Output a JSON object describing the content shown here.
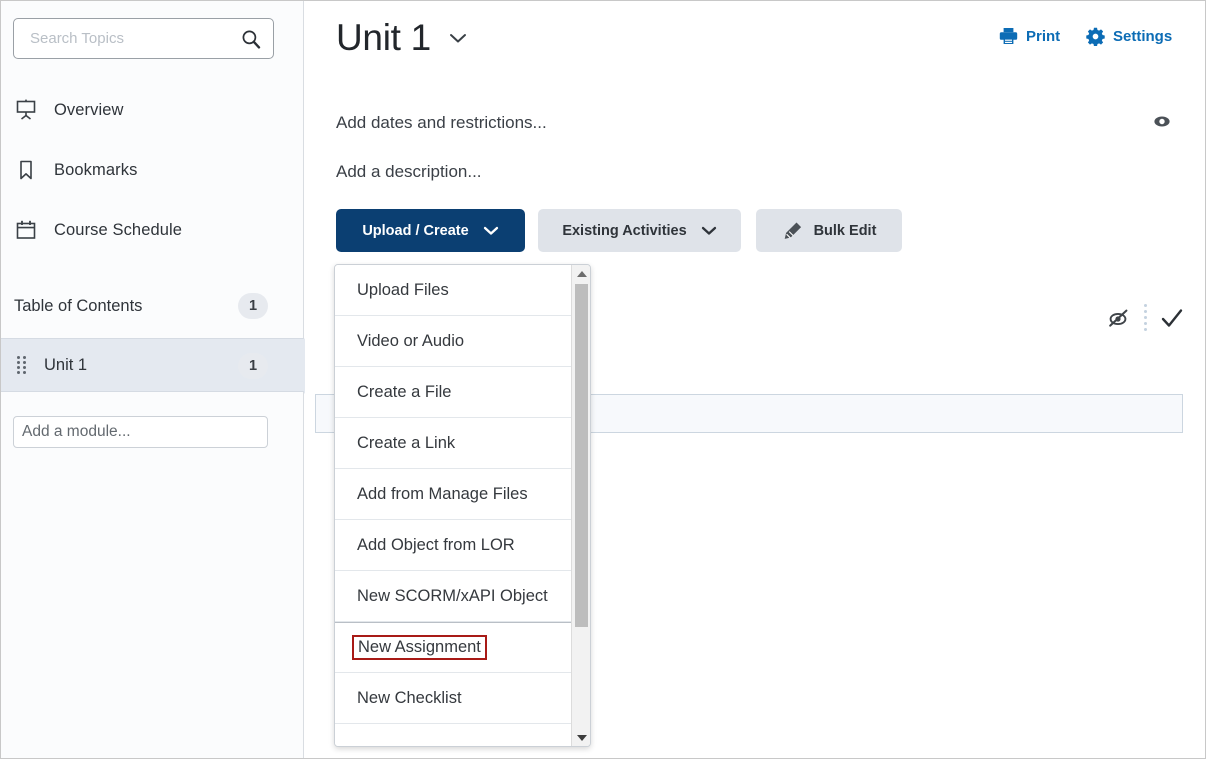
{
  "sidebar": {
    "search": {
      "placeholder": "Search Topics",
      "value": "",
      "icon": "search-icon"
    },
    "items": [
      {
        "label": "Overview",
        "icon": "presentation-screen-icon"
      },
      {
        "label": "Bookmarks",
        "icon": "bookmark-icon"
      },
      {
        "label": "Course Schedule",
        "icon": "calendar-icon"
      }
    ],
    "toc": {
      "label": "Table of Contents",
      "count": "1"
    },
    "module": {
      "label": "Unit 1",
      "count": "1",
      "icon": "drag-grip-icon",
      "selected": true
    },
    "add_module": {
      "placeholder": "Add a module..."
    }
  },
  "header": {
    "title": "Unit 1",
    "title_caret_icon": "chevron-down-icon",
    "print": {
      "label": "Print",
      "icon": "printer-icon"
    },
    "settings": {
      "label": "Settings",
      "icon": "gear-icon"
    },
    "preview_icon": "eye-icon"
  },
  "main": {
    "dates_line": "Add dates and restrictions...",
    "description_line": "Add a description...",
    "buttons": {
      "upload_create": {
        "label": "Upload / Create",
        "icon": "chevron-down-icon",
        "color": "#0b3f72"
      },
      "existing_activities": {
        "label": "Existing Activities",
        "icon": "chevron-down-icon",
        "color": "#dfe3e9"
      },
      "bulk_edit": {
        "label": "Bulk Edit",
        "icon": "pencil-edit-icon",
        "color": "#dfe3e9"
      }
    },
    "row_actions": {
      "visibility_icon": "eye-slash-icon",
      "more_icon": "vertical-dots-icon",
      "complete_icon": "checkmark-icon"
    }
  },
  "dropdown": {
    "items": [
      {
        "label": "Upload Files",
        "highlighted": false
      },
      {
        "label": "Video or Audio",
        "highlighted": false
      },
      {
        "label": "Create a File",
        "highlighted": false
      },
      {
        "label": "Create a Link",
        "highlighted": false
      },
      {
        "label": "Add from Manage Files",
        "highlighted": false
      },
      {
        "label": "Add Object from LOR",
        "highlighted": false
      },
      {
        "label": "New SCORM/xAPI Object",
        "highlighted": false
      },
      {
        "label": "New Assignment",
        "highlighted": true
      },
      {
        "label": "New Checklist",
        "highlighted": false
      }
    ],
    "highlight_color": "#a81a16",
    "scroll_up_icon": "triangle-up-icon",
    "scroll_down_icon": "triangle-down-icon"
  }
}
